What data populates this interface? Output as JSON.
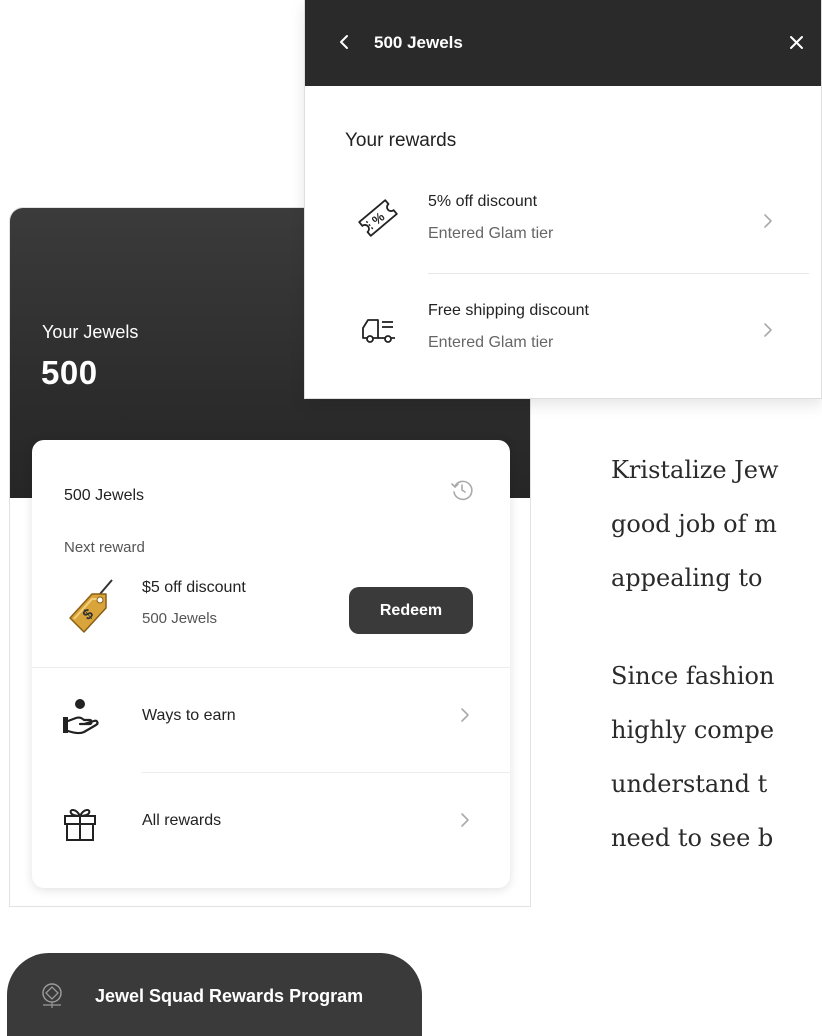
{
  "widget": {
    "jewels_label": "Your Jewels",
    "jewels_value": "500",
    "card": {
      "title": "500 Jewels",
      "next_label": "Next reward",
      "next_reward": {
        "name": "$5 off discount",
        "cost": "500 Jewels",
        "button": "Redeem"
      },
      "rows": [
        {
          "label": "Ways to earn",
          "icon": "hand-coin-icon"
        },
        {
          "label": "All rewards",
          "icon": "gift-icon"
        }
      ]
    },
    "launcher_label": "Jewel Squad Rewards Program"
  },
  "popup": {
    "title": "500 Jewels",
    "heading": "Your rewards",
    "rewards": [
      {
        "name": "5% off discount",
        "sub": "Entered Glam tier",
        "icon": "percent-ticket-icon"
      },
      {
        "name": "Free shipping discount",
        "sub": "Entered Glam tier",
        "icon": "delivery-truck-icon"
      }
    ]
  },
  "article": {
    "lines": [
      "Kristalize Jew",
      "good job of m",
      "appealing to",
      "Since fashion",
      "highly compe",
      "understand t",
      "need to see b"
    ]
  },
  "colors": {
    "header_dark": "#2a2a2a",
    "button_dark": "#3a3a3a",
    "tag_gold": "#d9a43a"
  }
}
